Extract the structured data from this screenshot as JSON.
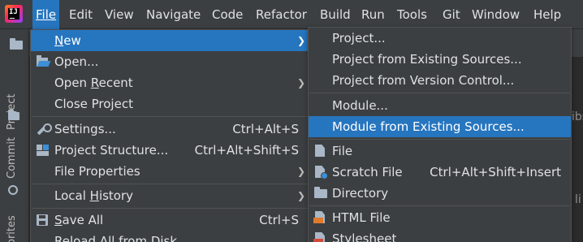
{
  "menubar": {
    "items": [
      {
        "label": "File"
      },
      {
        "label": "Edit"
      },
      {
        "label": "View"
      },
      {
        "label": "Navigate"
      },
      {
        "label": "Code"
      },
      {
        "label": "Refactor"
      },
      {
        "label": "Build"
      },
      {
        "label": "Run"
      },
      {
        "label": "Tools"
      },
      {
        "label": "Git"
      },
      {
        "label": "Window"
      },
      {
        "label": "Help"
      }
    ]
  },
  "toolstrip": {
    "tabs": [
      {
        "label": "Project"
      },
      {
        "label": "Commit"
      },
      {
        "label": "orites"
      }
    ]
  },
  "editor_fragments": [
    "ibs",
    "li"
  ],
  "file_menu": {
    "items": [
      {
        "label": "New",
        "shortcut": "",
        "submenu": true
      },
      {
        "label": "Open...",
        "shortcut": "",
        "icon": "open-folder-icon"
      },
      {
        "label": "Open Recent",
        "shortcut": "",
        "submenu": true
      },
      {
        "label": "Close Project",
        "shortcut": ""
      },
      {
        "label": "Settings...",
        "shortcut": "Ctrl+Alt+S",
        "icon": "wrench-icon"
      },
      {
        "label": "Project Structure...",
        "shortcut": "Ctrl+Alt+Shift+S",
        "icon": "project-structure-icon"
      },
      {
        "label": "File Properties",
        "shortcut": "",
        "submenu": true
      },
      {
        "label": "Local History",
        "shortcut": "",
        "submenu": true
      },
      {
        "label": "Save All",
        "shortcut": "Ctrl+S",
        "icon": "save-icon"
      },
      {
        "label": "Reload All from Disk",
        "shortcut": ""
      }
    ]
  },
  "new_menu": {
    "items": [
      {
        "label": "Project..."
      },
      {
        "label": "Project from Existing Sources..."
      },
      {
        "label": "Project from Version Control..."
      },
      {
        "label": "Module..."
      },
      {
        "label": "Module from Existing Sources..."
      },
      {
        "label": "File",
        "icon": "file-icon"
      },
      {
        "label": "Scratch File",
        "shortcut": "Ctrl+Alt+Shift+Insert",
        "icon": "scratch-file-icon"
      },
      {
        "label": "Directory",
        "icon": "directory-icon"
      },
      {
        "label": "HTML File",
        "icon": "html-file-icon"
      },
      {
        "label": "Stylesheet",
        "icon": "stylesheet-icon"
      }
    ]
  },
  "colors": {
    "highlight": "#2675bf",
    "menu_bg": "#3c3f41",
    "text": "#dfe1e5"
  }
}
